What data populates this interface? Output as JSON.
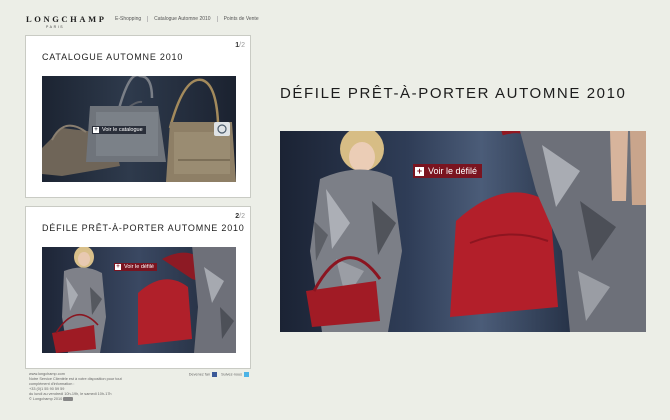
{
  "brand": {
    "logo": "LONGCHAMP",
    "sub": "PARIS"
  },
  "nav": [
    "E-Shopping",
    "Catalogue Automne 2010",
    "Points de Vente"
  ],
  "cards": [
    {
      "title": "CATALOGUE AUTOMNE 2010",
      "page_current": "1",
      "page_total": "/2",
      "cta": "Voir le catalogue"
    },
    {
      "title": "DÉFILE PRÊT-À-PORTER AUTOMNE 2010",
      "page_current": "2",
      "page_total": "/2",
      "cta": "Voir le défilé"
    }
  ],
  "main": {
    "title": "DÉFILE PRÊT-À-PORTER AUTOMNE 2010",
    "cta": "Voir le défilé"
  },
  "footer": {
    "site": "www.longchamp.com",
    "line1": "Notre Service Clientèle est à votre disposition pour tout",
    "line2": "complément d'information :",
    "phone": "+33 (0)1 55 90 59 59",
    "hours": "du lundi au vendredi 10h-19h, le samedi 10h-17h",
    "copyright": "© Longchamp 2010",
    "follow_fb": "Devenez fan",
    "follow_tw": "Suivez-nous"
  },
  "colors": {
    "background": "#eceee7",
    "accent_red": "#7a1420",
    "facebook": "#3b5998",
    "twitter": "#4cb3e6"
  },
  "icons": {
    "cta": "plus-icon",
    "facebook": "facebook-icon",
    "twitter": "twitter-icon",
    "zoom": "zoom-icon",
    "horse": "horse-logo-icon"
  }
}
